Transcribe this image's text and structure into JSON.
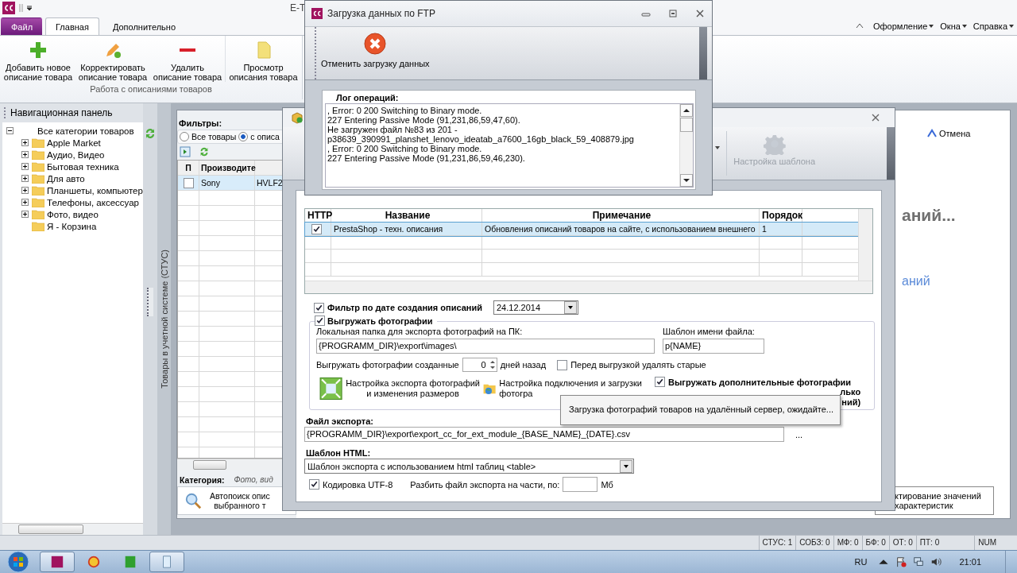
{
  "main_window": {
    "title": "E-T",
    "tabs": [
      {
        "label": "Файл",
        "kind": "file",
        "selected": false
      },
      {
        "label": "Главная",
        "kind": "tab",
        "selected": true
      },
      {
        "label": "Дополнительно",
        "kind": "tab",
        "selected": false
      }
    ],
    "menus": [
      {
        "label": "Оформление"
      },
      {
        "label": "Окна"
      },
      {
        "label": "Справка"
      }
    ],
    "ribbon": {
      "buttons": [
        {
          "kind": "add",
          "label": "Добавить новое\nописание товара"
        },
        {
          "kind": "edit",
          "label": "Корректировать\nописание товара"
        },
        {
          "kind": "delete",
          "label": "Удалить\nописание товара"
        },
        {
          "kind": "view",
          "label": "Просмотр\nописания товара"
        }
      ],
      "group_label": "Работа с описаниями товаров"
    }
  },
  "nav": {
    "title": "Навигационная панель",
    "tree": [
      {
        "label": "Все категории товаров",
        "expanded": true,
        "children": [
          {
            "label": "Apple Market",
            "expanded": false
          },
          {
            "label": "Аудио, Видео",
            "expanded": false
          },
          {
            "label": "Бытовая техника",
            "expanded": false
          },
          {
            "label": "Для авто",
            "expanded": false
          },
          {
            "label": "Планшеты, компьютер",
            "expanded": false
          },
          {
            "label": "Телефоны, аксессуар",
            "expanded": false
          },
          {
            "label": "Фото, видео",
            "expanded": false
          },
          {
            "label": "Я - Корзина"
          }
        ]
      }
    ]
  },
  "products": {
    "side_tab": "Товары в учетной системе (СТУС)",
    "filters_label": "Фильтры:",
    "radios": [
      {
        "label": "Все товары",
        "selected": false
      },
      {
        "label": "с описа",
        "selected": true
      }
    ],
    "check_column": "П",
    "columns": [
      "Производите"
    ],
    "rows": [
      {
        "checked": false,
        "selected": true,
        "cells": [
          "Sony",
          "HVLF2"
        ]
      }
    ],
    "category_label": "Категория:",
    "category_value": "Фото, вид",
    "autosearch": "Автопоиск опис\nвыбранного т"
  },
  "right_panel": {
    "cancel": "Отмена",
    "heading": "аний...",
    "link": "аний",
    "button": "ктирование значений\nхарактеристик"
  },
  "export_dialog": {
    "toolbar_button": {
      "label": "Настройка шаблона",
      "disabled": true
    },
    "table": {
      "check_column": "HTTP",
      "columns": [
        "Название",
        "Примечание",
        "Порядок"
      ],
      "rows": [
        {
          "checked": true,
          "selected": true,
          "cells": [
            "PrestaShop - техн. описания",
            "Обновления описаний товаров на сайте, с использованием внешнего",
            "1"
          ]
        }
      ]
    },
    "date_filter": {
      "checked": true,
      "label": "Фильтр по дате создания описаний",
      "value": "24.12.2014"
    },
    "photos": {
      "checked": true,
      "label": "Выгружать фотографии",
      "folder_label": "Локальная папка для экспорта фотографий на ПК:",
      "folder_value": "{PROGRAMM_DIR}\\export\\images\\",
      "template_label": "Шаблон имени файла:",
      "template_value": "p{NAME}",
      "days_before": "Выгружать фотографии созданные",
      "days_value": "0",
      "days_after": "дней назад",
      "delete_old": {
        "checked": false,
        "label": "Перед выгрузкой удалять старые"
      },
      "buttons": [
        {
          "kind": "resize",
          "label": "Настройка экспорта фотографий\nи изменения размеров"
        },
        {
          "kind": "upload",
          "label": "Настройка подключения и загрузки\nфотогра"
        }
      ],
      "extra": {
        "checked": true,
        "label": "Выгружать дополнительные фотографии"
      },
      "fragments": [
        "лько",
        "ний)"
      ]
    },
    "export_file": {
      "label": "Файл экспорта:",
      "value": "{PROGRAMM_DIR}\\export\\export_cc_for_ext_module_{BASE_NAME}_{DATE}.csv",
      "browse": "..."
    },
    "html_template": {
      "label": "Шаблон HTML:",
      "value": "Шаблон экспорта с использованием html таблиц  <table>"
    },
    "utf8": {
      "checked": true,
      "label": "Кодировка UTF-8"
    },
    "split": {
      "label": "Разбить файл экспорта на части, по:",
      "unit": "Мб"
    }
  },
  "ftp_dialog": {
    "title": "Загрузка данных по FTP",
    "cancel_button": "Отменить загрузку данных",
    "log_label": "Лог операций:",
    "log": [
      ", Error: 0 200 Switching to Binary mode.",
      "227 Entering Passive Mode (91,231,86,59,47,60).",
      "Не загружен файл №83 из 201 -",
      "p38639_390991_planshet_lenovo_ideatab_a7600_16gb_black_59_408879.jpg",
      ", Error: 0 200 Switching to Binary mode.",
      "227 Entering Passive Mode (91,231,86,59,46,230)."
    ]
  },
  "tooltip": "Загрузка фотографий товаров на удалённый сервер, ожидайте...",
  "status_bar": [
    "СТУС: 1",
    "СОБЗ: 0",
    "МФ: 0",
    "БФ: 0",
    "ОТ: 0",
    "ПТ: 0",
    "NUM"
  ],
  "taskbar": {
    "apps": [
      {
        "kind": "cc",
        "active": true
      },
      {
        "kind": "onec",
        "active": false
      },
      {
        "kind": "pl",
        "active": false
      },
      {
        "kind": "doc",
        "active": true
      }
    ],
    "language": "RU",
    "time": "21:01"
  }
}
